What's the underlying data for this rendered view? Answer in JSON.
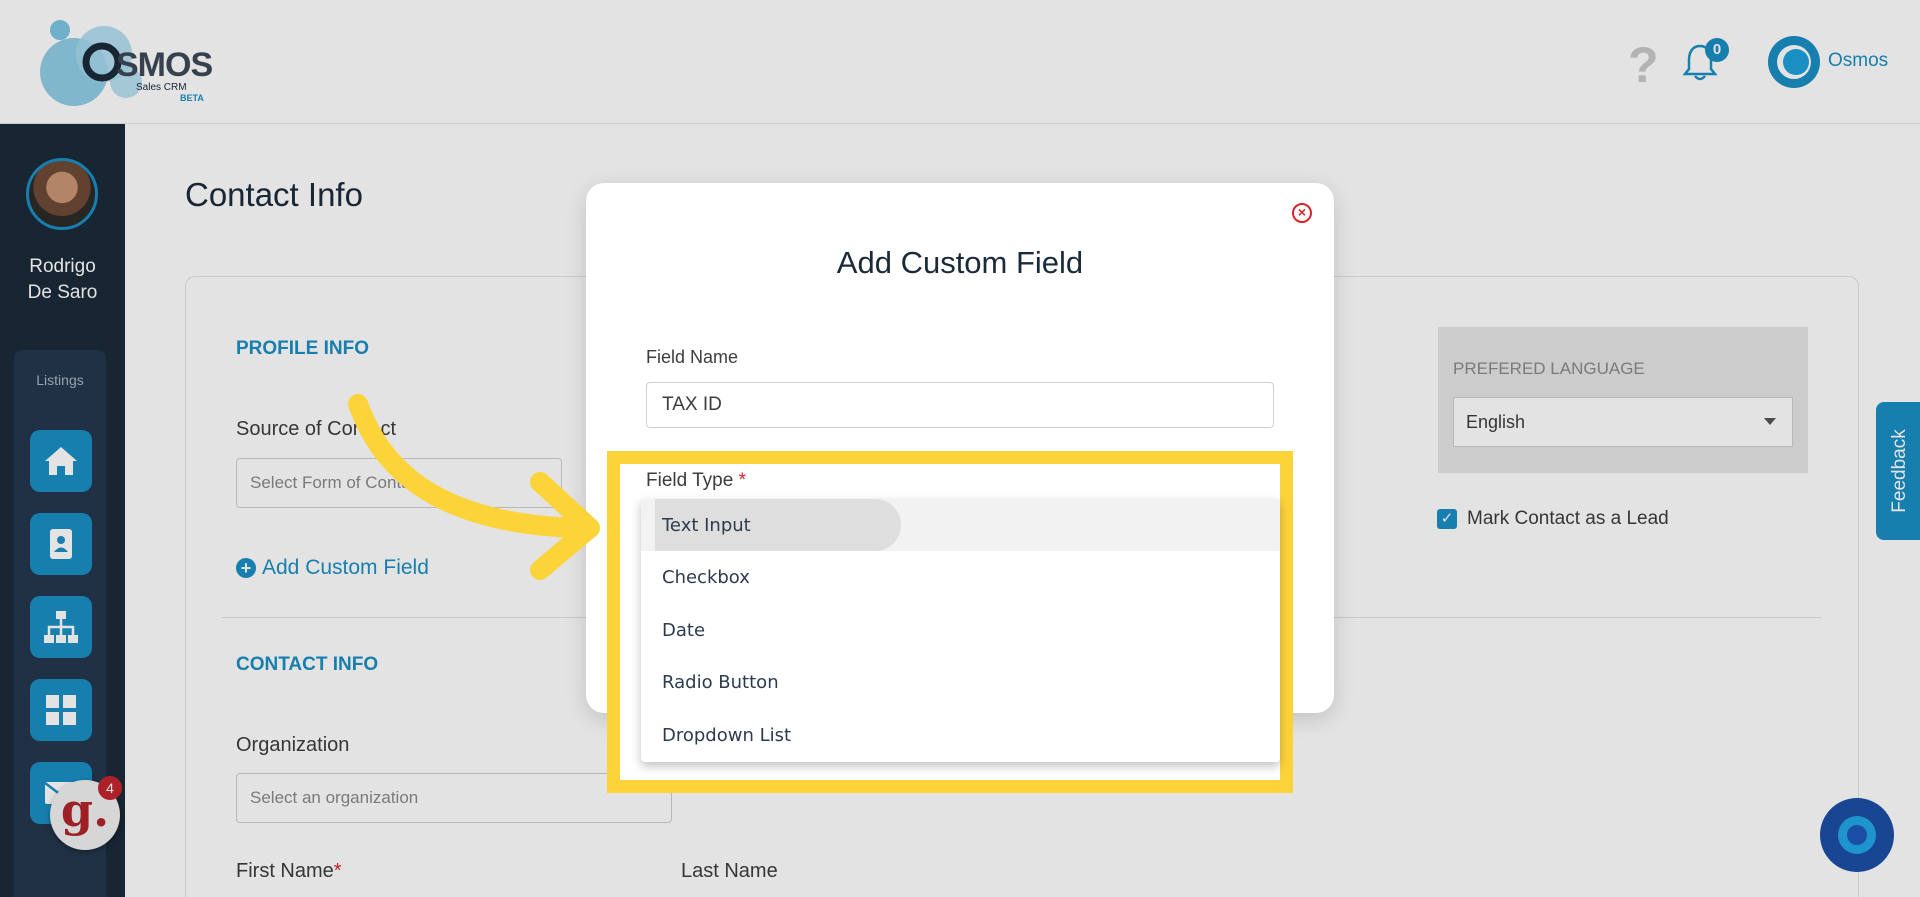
{
  "header": {
    "logo": {
      "name": "OSMOS",
      "subtitle": "Sales CRM",
      "tag": "BETA"
    },
    "notification_count": "0",
    "user_name": "Osmos",
    "icons": [
      "help-icon",
      "bell-icon",
      "user-avatar-icon"
    ]
  },
  "sidebar": {
    "user_name_line1": "Rodrigo",
    "user_name_line2": "De Saro",
    "listings_label": "Listings",
    "items": [
      {
        "icon": "home-icon"
      },
      {
        "icon": "contact-card-icon"
      },
      {
        "icon": "org-chart-icon"
      },
      {
        "icon": "grid-icon"
      },
      {
        "icon": "mail-icon"
      }
    ],
    "badge_letter": "g.",
    "badge_count": "4"
  },
  "page": {
    "title": "Contact Info",
    "profile_section": "PROFILE INFO",
    "source_label": "Source of Contact",
    "source_placeholder": "Select Form of Contact",
    "add_custom_label": "Add Custom Field",
    "contact_section": "CONTACT INFO",
    "organization_label": "Organization",
    "organization_placeholder": "Select an organization",
    "first_name_label": "First Name",
    "last_name_label": "Last Name",
    "required_mark": "*",
    "language_label": "PREFERED LANGUAGE",
    "language_value": "English",
    "lead_label": "Mark Contact as a Lead",
    "lead_checked": true,
    "feedback_label": "Feedback"
  },
  "modal": {
    "title": "Add Custom Field",
    "field_name_label": "Field Name",
    "field_name_value": "TAX ID",
    "field_type_label": "Field Type",
    "required_mark": "*",
    "options": [
      "Text Input",
      "Checkbox",
      "Date",
      "Radio Button",
      "Dropdown List"
    ],
    "highlighted_option": "Text Input"
  },
  "colors": {
    "accent": "#1a8fc4",
    "sidebar": "#1b2a3a",
    "highlight": "#fdd33a",
    "required": "#d9232d"
  }
}
